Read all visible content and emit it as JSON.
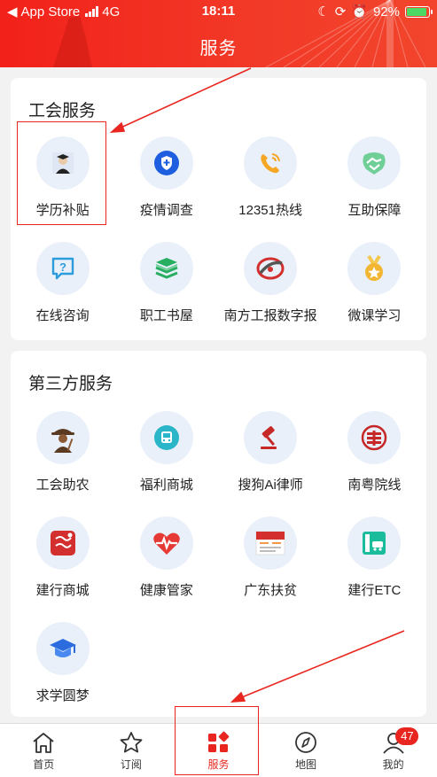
{
  "status_bar": {
    "back_app": "App Store",
    "network": "4G",
    "time": "18:11",
    "battery": "92%"
  },
  "header": {
    "title": "服务"
  },
  "union_services": {
    "title": "工会服务",
    "items": [
      {
        "label": "学历补贴",
        "icon": "graduate-icon"
      },
      {
        "label": "疫情调查",
        "icon": "shield-icon"
      },
      {
        "label": "12351热线",
        "icon": "phone-icon"
      },
      {
        "label": "互助保障",
        "icon": "handshake-icon"
      },
      {
        "label": "在线咨询",
        "icon": "question-chat-icon"
      },
      {
        "label": "职工书屋",
        "icon": "books-icon"
      },
      {
        "label": "南方工报数字报",
        "icon": "newspaper-logo-icon"
      },
      {
        "label": "微课学习",
        "icon": "medal-icon"
      }
    ]
  },
  "third_party": {
    "title": "第三方服务",
    "items": [
      {
        "label": "工会助农",
        "icon": "farmer-icon"
      },
      {
        "label": "福利商城",
        "icon": "bus-icon"
      },
      {
        "label": "搜狗Ai律师",
        "icon": "gavel-icon"
      },
      {
        "label": "南粤院线",
        "icon": "cinema-icon"
      },
      {
        "label": "建行商城",
        "icon": "shop-icon"
      },
      {
        "label": "健康管家",
        "icon": "heart-pulse-icon"
      },
      {
        "label": "广东扶贫",
        "icon": "poverty-page-icon"
      },
      {
        "label": "建行ETC",
        "icon": "etc-icon"
      },
      {
        "label": "求学圆梦",
        "icon": "graduation-cap-icon"
      }
    ]
  },
  "tab_bar": {
    "tabs": [
      {
        "label": "首页",
        "icon": "home-icon"
      },
      {
        "label": "订阅",
        "icon": "star-icon"
      },
      {
        "label": "服务",
        "icon": "service-grid-icon"
      },
      {
        "label": "地图",
        "icon": "compass-icon"
      },
      {
        "label": "我的",
        "icon": "user-icon"
      }
    ],
    "active": "服务",
    "badge": "47"
  },
  "colors": {
    "brand_red": "#e8261f",
    "icon_bg": "#e9f0fa"
  }
}
